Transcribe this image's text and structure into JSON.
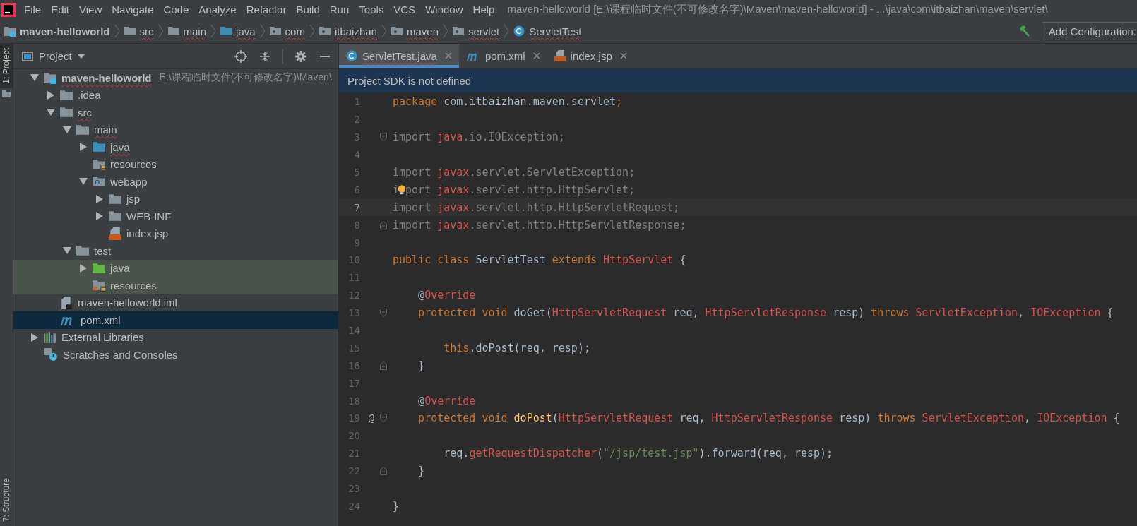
{
  "window": {
    "title": "maven-helloworld [E:\\课程临时文件(不可修改名字)\\Maven\\maven-helloworld] - ...\\java\\com\\itbaizhan\\maven\\servlet\\"
  },
  "menu": [
    "File",
    "Edit",
    "View",
    "Navigate",
    "Code",
    "Analyze",
    "Refactor",
    "Build",
    "Run",
    "Tools",
    "VCS",
    "Window",
    "Help"
  ],
  "breadcrumb": [
    {
      "label": "maven-helloworld",
      "kind": "module",
      "typo": false
    },
    {
      "label": "src",
      "kind": "folder",
      "typo": true
    },
    {
      "label": "main",
      "kind": "folder",
      "typo": true
    },
    {
      "label": "java",
      "kind": "source",
      "typo": true
    },
    {
      "label": "com",
      "kind": "package",
      "typo": true
    },
    {
      "label": "itbaizhan",
      "kind": "package",
      "typo": true
    },
    {
      "label": "maven",
      "kind": "package",
      "typo": true
    },
    {
      "label": "servlet",
      "kind": "package",
      "typo": true
    },
    {
      "label": "ServletTest",
      "kind": "class",
      "typo": true
    }
  ],
  "run_config": {
    "label": "Add Configuration."
  },
  "side_stripe": {
    "top": "1: Project",
    "bottom": "7: Structure"
  },
  "project_panel": {
    "title": "Project",
    "tree": [
      {
        "label": "maven-helloworld",
        "note": "E:\\课程临时文件(不可修改名字)\\Maven\\",
        "kind": "module",
        "expanded": true,
        "selected": false,
        "highlighted": false,
        "typo": true,
        "children": [
          {
            "label": ".idea",
            "kind": "folder",
            "expanded": false,
            "selected": false,
            "highlighted": false,
            "typo": false
          },
          {
            "label": "src",
            "kind": "folder",
            "expanded": true,
            "selected": false,
            "highlighted": false,
            "typo": true,
            "children": [
              {
                "label": "main",
                "kind": "folder",
                "expanded": true,
                "selected": false,
                "highlighted": false,
                "typo": true,
                "children": [
                  {
                    "label": "java",
                    "kind": "source",
                    "expanded": false,
                    "selected": false,
                    "highlighted": false,
                    "typo": true
                  },
                  {
                    "label": "resources",
                    "kind": "resources",
                    "selected": false,
                    "highlighted": false,
                    "typo": false
                  },
                  {
                    "label": "webapp",
                    "kind": "web",
                    "expanded": true,
                    "selected": false,
                    "highlighted": false,
                    "typo": false,
                    "children": [
                      {
                        "label": "jsp",
                        "kind": "folder",
                        "expanded": false,
                        "selected": false,
                        "highlighted": false,
                        "typo": false
                      },
                      {
                        "label": "WEB-INF",
                        "kind": "folder",
                        "expanded": false,
                        "selected": false,
                        "highlighted": false,
                        "typo": false
                      },
                      {
                        "label": "index.jsp",
                        "kind": "jsp",
                        "selected": false,
                        "highlighted": false,
                        "typo": false
                      }
                    ]
                  }
                ]
              },
              {
                "label": "test",
                "kind": "folder",
                "expanded": true,
                "selected": false,
                "highlighted": false,
                "typo": false,
                "children": [
                  {
                    "label": "java",
                    "kind": "test-source",
                    "expanded": false,
                    "selected": false,
                    "highlighted": true,
                    "typo": false
                  },
                  {
                    "label": "resources",
                    "kind": "test-resources",
                    "selected": false,
                    "highlighted": true,
                    "typo": false
                  }
                ]
              }
            ]
          },
          {
            "label": "maven-helloworld.iml",
            "kind": "iml",
            "selected": false,
            "highlighted": false,
            "typo": false
          },
          {
            "label": "pom.xml",
            "kind": "maven",
            "selected": true,
            "highlighted": false,
            "typo": false
          }
        ]
      },
      {
        "label": "External Libraries",
        "kind": "libraries",
        "expanded": false,
        "selected": false,
        "highlighted": false,
        "typo": false
      },
      {
        "label": "Scratches and Consoles",
        "kind": "scratches",
        "selected": false,
        "highlighted": false,
        "typo": false
      }
    ]
  },
  "tabs": [
    {
      "label": "ServletTest.java",
      "kind": "class",
      "selected": true,
      "typo": true
    },
    {
      "label": "pom.xml",
      "kind": "maven",
      "selected": false,
      "typo": false
    },
    {
      "label": "index.jsp",
      "kind": "jsp",
      "selected": false,
      "typo": false
    }
  ],
  "notification": "Project SDK is not defined",
  "code": [
    {
      "number": "1",
      "current": false,
      "tokens": [
        {
          "t": "package",
          "kind": "kw"
        },
        {
          "t": " com.itbaizhan.maven.servlet",
          "kind": "plain"
        },
        {
          "t": ";",
          "kind": "kw"
        }
      ]
    },
    {
      "number": "2",
      "current": false
    },
    {
      "number": "3",
      "current": false,
      "fold": {
        "kind": "start"
      },
      "tokens": [
        {
          "t": "import ",
          "kind": "dim"
        },
        {
          "t": "java",
          "kind": "err"
        },
        {
          "t": ".io.IOException;",
          "kind": "dim"
        }
      ]
    },
    {
      "number": "4",
      "current": false
    },
    {
      "number": "5",
      "current": false,
      "tokens": [
        {
          "t": "import ",
          "kind": "dim"
        },
        {
          "t": "javax",
          "kind": "err"
        },
        {
          "t": ".servlet.ServletException;",
          "kind": "dim"
        }
      ]
    },
    {
      "number": "6",
      "current": false,
      "tokens": [
        {
          "t": "i",
          "kind": "dim"
        },
        {
          "kind": "bulb"
        },
        {
          "t": "port ",
          "kind": "dim"
        },
        {
          "t": "javax",
          "kind": "err"
        },
        {
          "t": ".servlet.http.HttpServlet;",
          "kind": "dim"
        }
      ]
    },
    {
      "number": "7",
      "current": true,
      "tokens": [
        {
          "t": "import ",
          "kind": "dim"
        },
        {
          "t": "javax",
          "kind": "err"
        },
        {
          "t": ".servlet.http.HttpServletRequest;",
          "kind": "dim"
        }
      ]
    },
    {
      "number": "8",
      "current": false,
      "fold": {
        "kind": "end"
      },
      "tokens": [
        {
          "t": "import ",
          "kind": "dim"
        },
        {
          "t": "javax",
          "kind": "err"
        },
        {
          "t": ".servlet.http.HttpServletResponse;",
          "kind": "dim"
        }
      ]
    },
    {
      "number": "9",
      "current": false
    },
    {
      "number": "10",
      "current": false,
      "tokens": [
        {
          "t": "public class",
          "kind": "kw"
        },
        {
          "t": " ServletTest ",
          "kind": "plain"
        },
        {
          "t": "extends",
          "kind": "kw"
        },
        {
          "t": " HttpServlet",
          "kind": "err"
        },
        {
          "t": " {",
          "kind": "plain"
        }
      ]
    },
    {
      "number": "11",
      "current": false
    },
    {
      "number": "12",
      "current": false,
      "tokens": [
        {
          "t": "    @",
          "kind": "plain"
        },
        {
          "t": "Override",
          "kind": "err"
        }
      ]
    },
    {
      "number": "13",
      "current": false,
      "fold": {
        "kind": "start"
      },
      "tokens": [
        {
          "t": "    protected void",
          "kind": "kw"
        },
        {
          "t": " doGet(",
          "kind": "plain"
        },
        {
          "t": "HttpServletRequest",
          "kind": "err"
        },
        {
          "t": " req, ",
          "kind": "plain"
        },
        {
          "t": "HttpServletResponse",
          "kind": "err"
        },
        {
          "t": " resp) ",
          "kind": "plain"
        },
        {
          "t": "throws",
          "kind": "kw"
        },
        {
          "t": " ServletException",
          "kind": "err"
        },
        {
          "t": ", ",
          "kind": "plain"
        },
        {
          "t": "IOException",
          "kind": "err"
        },
        {
          "t": " {",
          "kind": "plain"
        }
      ]
    },
    {
      "number": "14",
      "current": false
    },
    {
      "number": "15",
      "current": false,
      "tokens": [
        {
          "t": "        this",
          "kind": "kw"
        },
        {
          "t": ".doPost(req, resp);",
          "kind": "plain"
        }
      ]
    },
    {
      "number": "16",
      "current": false,
      "fold": {
        "kind": "end"
      },
      "tokens": [
        {
          "t": "    }",
          "kind": "plain"
        }
      ]
    },
    {
      "number": "17",
      "current": false
    },
    {
      "number": "18",
      "current": false,
      "tokens": [
        {
          "t": "    @",
          "kind": "plain"
        },
        {
          "t": "Override",
          "kind": "err"
        }
      ]
    },
    {
      "number": "19",
      "current": false,
      "marker": "@",
      "fold": {
        "kind": "start"
      },
      "tokens": [
        {
          "t": "    protected void",
          "kind": "kw"
        },
        {
          "t": " doPost",
          "kind": "method"
        },
        {
          "t": "(",
          "kind": "plain"
        },
        {
          "t": "HttpServletRequest",
          "kind": "err"
        },
        {
          "t": " req, ",
          "kind": "plain"
        },
        {
          "t": "HttpServletResponse",
          "kind": "err"
        },
        {
          "t": " resp) ",
          "kind": "plain"
        },
        {
          "t": "throws",
          "kind": "kw"
        },
        {
          "t": " ServletException",
          "kind": "err"
        },
        {
          "t": ", ",
          "kind": "plain"
        },
        {
          "t": "IOException",
          "kind": "err"
        },
        {
          "t": " {",
          "kind": "plain"
        }
      ]
    },
    {
      "number": "20",
      "current": false
    },
    {
      "number": "21",
      "current": false,
      "tokens": [
        {
          "t": "        req.",
          "kind": "plain"
        },
        {
          "t": "getRequestDispatcher",
          "kind": "err"
        },
        {
          "t": "(",
          "kind": "plain"
        },
        {
          "t": "\"/jsp/test.jsp\"",
          "kind": "str"
        },
        {
          "t": ").forward(req, resp);",
          "kind": "plain"
        }
      ]
    },
    {
      "number": "22",
      "current": false,
      "fold": {
        "kind": "end"
      },
      "tokens": [
        {
          "t": "    }",
          "kind": "plain"
        }
      ]
    },
    {
      "number": "23",
      "current": false
    },
    {
      "number": "24",
      "current": false,
      "tokens": [
        {
          "t": "}",
          "kind": "plain"
        }
      ]
    }
  ]
}
